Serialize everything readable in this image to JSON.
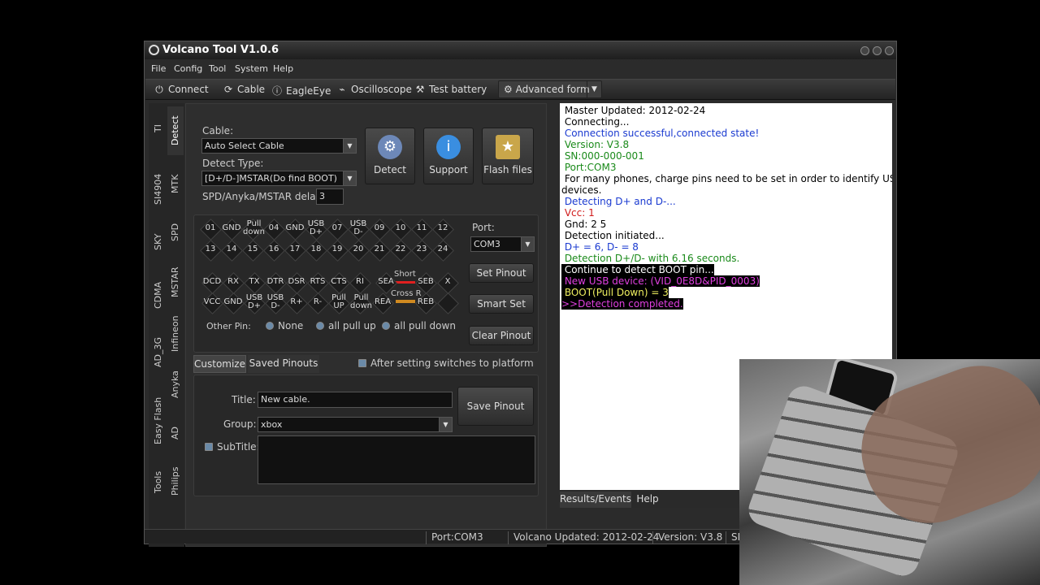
{
  "window": {
    "title": "Volcano Tool V1.0.6"
  },
  "menu": [
    "File",
    "Config",
    "Tool",
    "System",
    "Help"
  ],
  "toolbar": {
    "connect": "Connect",
    "cable": "Cable",
    "eagleeye": "EagleEye",
    "oscilloscope": "Oscilloscope",
    "test_battery": "Test battery",
    "advanced_form": "Advanced form"
  },
  "left_tabs": {
    "col1": [
      "TI",
      "SI4904",
      "SKY",
      "CDMA",
      "AD_3G",
      "Easy Flash",
      "Tools"
    ],
    "col2": [
      "Detect",
      "MTK",
      "SPD",
      "MSTAR",
      "Infineon",
      "Anyka",
      "AD",
      "Philips"
    ]
  },
  "detect": {
    "cable_label": "Cable:",
    "cable_value": "Auto Select Cable",
    "detect_type_label": "Detect Type:",
    "detect_type_value": "[D+/D-]MSTAR(Do find BOOT)",
    "delay_label": "SPD/Anyka/MSTAR delay(",
    "delay_value": "3",
    "buttons": {
      "detect": "Detect",
      "support": "Support",
      "flash_files": "Flash files"
    }
  },
  "pins": {
    "row1": [
      "01",
      "GND",
      "Pull down",
      "04",
      "GND",
      "USB D+",
      "07",
      "USB D-",
      "09",
      "10",
      "11",
      "12"
    ],
    "row2": [
      "13",
      "14",
      "15",
      "16",
      "17",
      "18",
      "19",
      "20",
      "21",
      "22",
      "23",
      "24"
    ],
    "row3": [
      "DCD",
      "RX",
      "TX",
      "DTR",
      "DSR",
      "RTS",
      "CTS",
      "RI"
    ],
    "row4": [
      "VCC",
      "GND",
      "USB D+",
      "USB D-",
      "R+",
      "R-",
      "Pull UP",
      "Pull down"
    ],
    "sea": "SEA",
    "seb": "SEB",
    "short": "Short",
    "x": "X",
    "rea": "REA",
    "reb": "REB",
    "cross": "Cross R",
    "other_pin_label": "Other Pin:",
    "none": "None",
    "all_pull_up": "all pull up",
    "all_pull_down": "all pull down"
  },
  "port": {
    "label": "Port:",
    "value": "COM3",
    "set_pinout": "Set Pinout",
    "smart_set": "Smart Set",
    "clear_pinout": "Clear Pinout"
  },
  "customize": {
    "tab1": "Customize",
    "tab2": "Saved Pinouts",
    "after_setting": "After setting switches to platform",
    "title_label": "Title:",
    "title_value": "New cable.",
    "group_label": "Group:",
    "group_value": "xbox",
    "subtitle_label": "SubTitle:",
    "save_pinout": "Save Pinout"
  },
  "log": [
    {
      "t": " Master Updated: 2012-02-24",
      "c": "#000",
      "bg": ""
    },
    {
      "t": " Connecting...",
      "c": "#000",
      "bg": ""
    },
    {
      "t": " Connection successful,connected state!",
      "c": "#1a3ad0",
      "bg": ""
    },
    {
      "t": " Version: V3.8",
      "c": "#1a8a1a",
      "bg": ""
    },
    {
      "t": " SN:000-000-001",
      "c": "#1a8a1a",
      "bg": ""
    },
    {
      "t": " Port:COM3",
      "c": "#1a8a1a",
      "bg": ""
    },
    {
      "t": " For many phones, charge pins need to be set in order to identify USB",
      "c": "#000",
      "bg": ""
    },
    {
      "t": "devices.",
      "c": "#000",
      "bg": ""
    },
    {
      "t": " Detecting D+ and D-...",
      "c": "#1a3ad0",
      "bg": ""
    },
    {
      "t": " Vcc: 1",
      "c": "#d01a1a",
      "bg": ""
    },
    {
      "t": " Gnd: 2 5",
      "c": "#000",
      "bg": ""
    },
    {
      "t": " Detection initiated...",
      "c": "#000",
      "bg": ""
    },
    {
      "t": " D+ = 6, D- = 8",
      "c": "#1a3ad0",
      "bg": ""
    },
    {
      "t": " Detection D+/D- with 6.16 seconds.",
      "c": "#1a8a1a",
      "bg": ""
    },
    {
      "t": " Continue to detect BOOT pin...",
      "c": "#fff",
      "bg": "#000"
    },
    {
      "t": " New USB device: (VID_0E8D&PID_0003)",
      "c": "#e040e0",
      "bg": "#000"
    },
    {
      "t": " BOOT(Pull Down) = 3",
      "c": "#f0f060",
      "bg": "#000"
    },
    {
      "t": ">>Detection completed.",
      "c": "#e040e0",
      "bg": "#000"
    }
  ],
  "log_tabs": [
    "Results/Events",
    "Help"
  ],
  "status": {
    "port": "Port:COM3",
    "updated": "Volcano Updated: 2012-02-24",
    "version": "Version: V3.8",
    "sn": "SN"
  }
}
